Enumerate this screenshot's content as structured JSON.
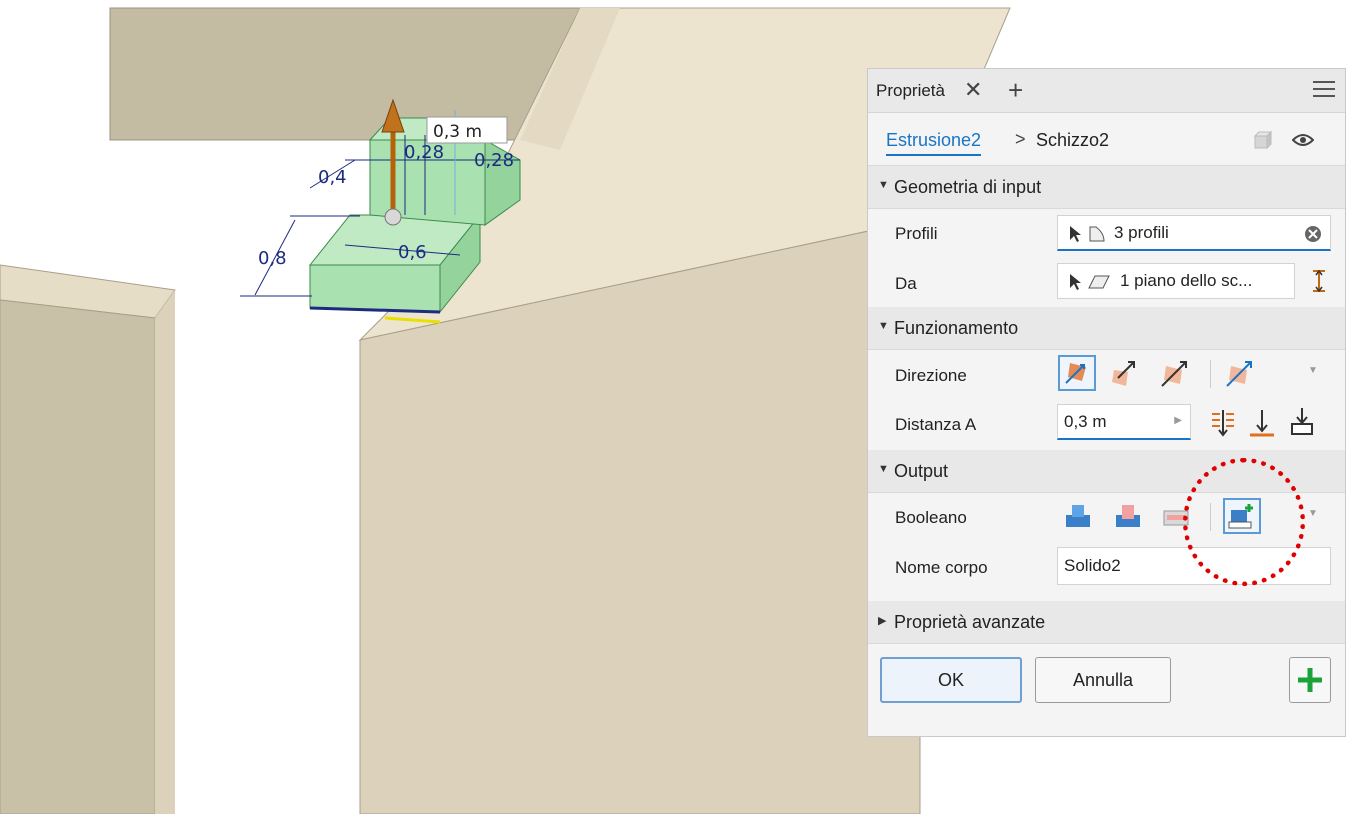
{
  "viewport": {
    "dimensions": {
      "height_value": "0,3 m",
      "d_028_left": "0,28",
      "d_028_right": "0,28",
      "d_04": "0,4",
      "d_06": "0,6",
      "d_08": "0,8"
    }
  },
  "panel": {
    "tab_label": "Proprietà",
    "tab_close": "✕",
    "tab_add": "+",
    "breadcrumb": {
      "feature": "Estrusione2",
      "separator": ">",
      "sketch": "Schizzo2"
    },
    "sections": {
      "input_geometry": "Geometria di input",
      "behavior": "Funzionamento",
      "output": "Output",
      "advanced": "Proprietà avanzate"
    },
    "rows": {
      "profiles_label": "Profili",
      "profiles_value": "3 profili",
      "from_label": "Da",
      "from_value": "1 piano dello sc...",
      "direction_label": "Direzione",
      "distance_label": "Distanza A",
      "distance_value": "0,3 m",
      "boolean_label": "Booleano",
      "body_name_label": "Nome corpo",
      "body_name_value": "Solido2"
    },
    "buttons": {
      "ok": "OK",
      "cancel": "Annulla"
    }
  },
  "colors": {
    "accent": "#1a74c5",
    "wall_face": "#dcd2bb",
    "wall_top": "#ece4cf",
    "preview_green": "#a9e2b0",
    "dimension_blue": "#1c2a80",
    "highlight_red": "#e00000"
  }
}
